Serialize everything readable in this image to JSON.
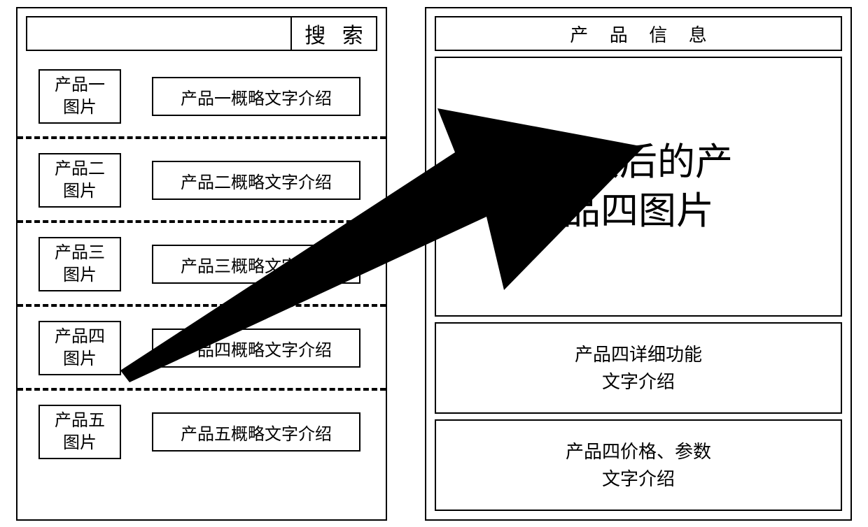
{
  "left": {
    "search_button": "搜 索",
    "products": [
      {
        "thumb": "产品一\n图片",
        "summary": "产品一概略文字介绍"
      },
      {
        "thumb": "产品二\n图片",
        "summary": "产品二概略文字介绍"
      },
      {
        "thumb": "产品三\n图片",
        "summary": "产品三概略文字介绍"
      },
      {
        "thumb": "产品四\n图片",
        "summary": "产品四概略文字介绍"
      },
      {
        "thumb": "产品五\n图片",
        "summary": "产品五概略文字介绍"
      }
    ]
  },
  "right": {
    "header": "产 品 信 息",
    "enlarged_image_label": "放大后的产\n品四图片",
    "detail_function": "产品四详细功能\n文字介绍",
    "detail_price": "产品四价格、参数\n文字介绍"
  }
}
